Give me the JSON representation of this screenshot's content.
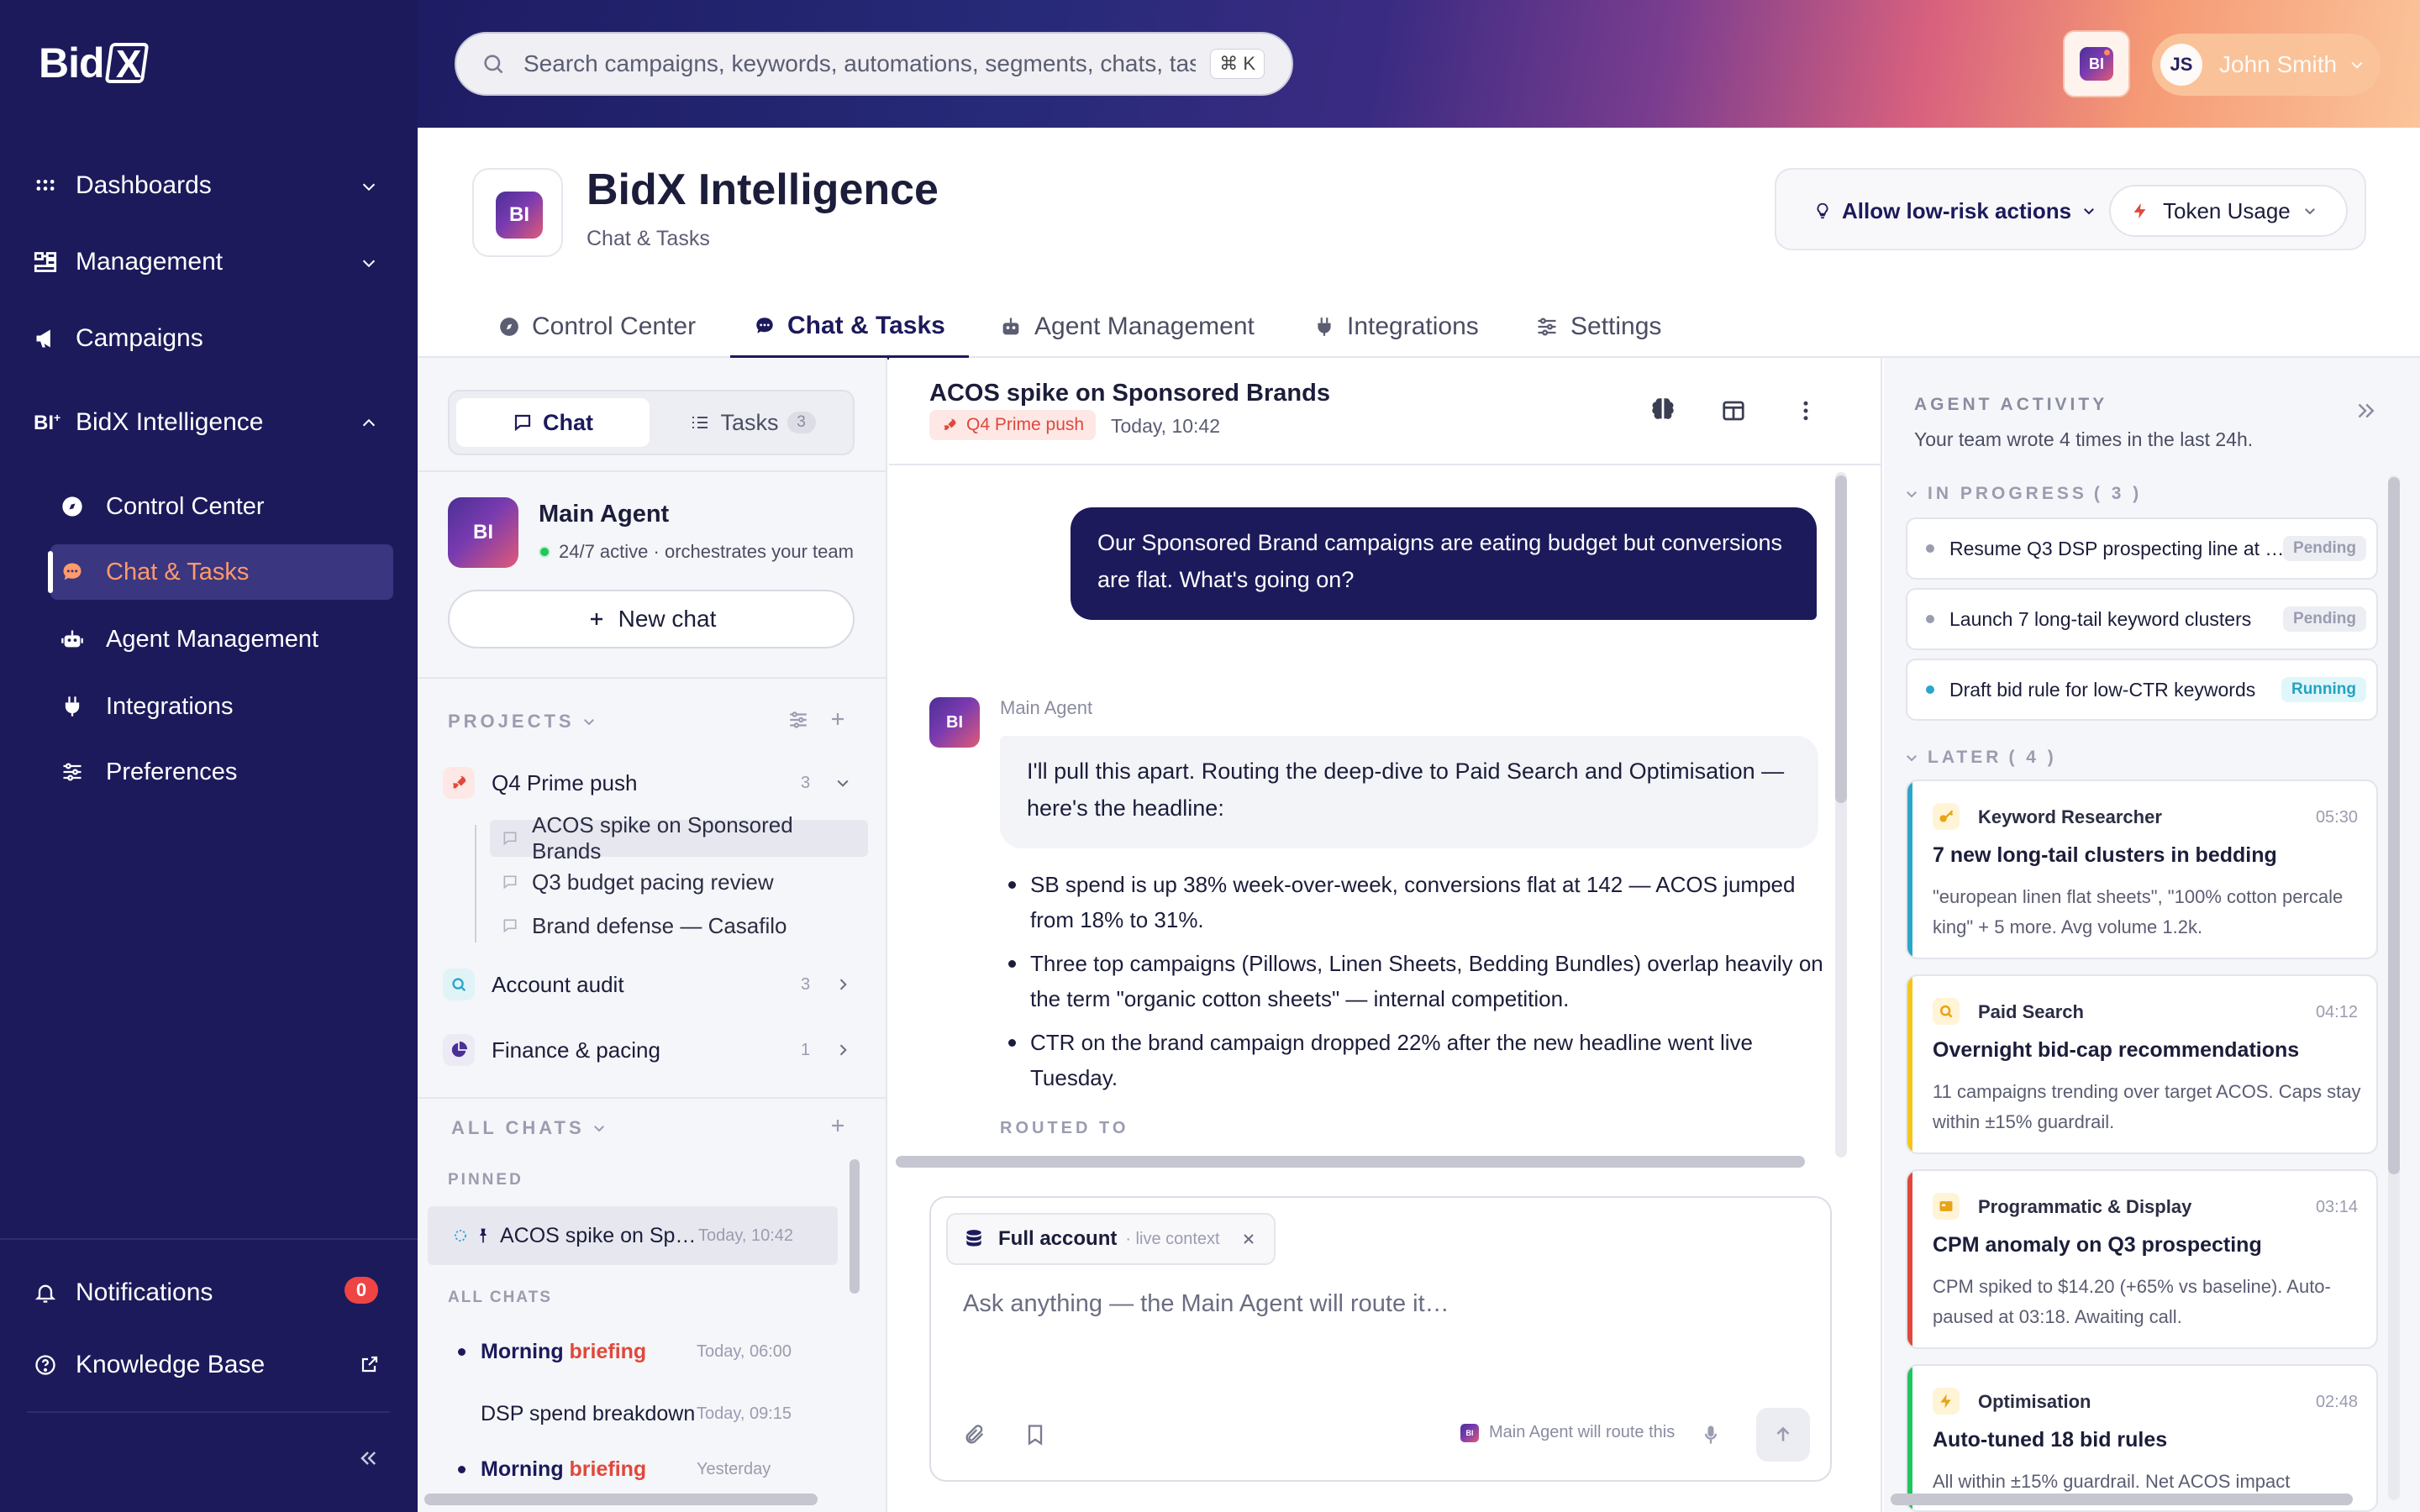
{
  "brand": {
    "logo_text": "Bid",
    "logo_mark": "X"
  },
  "sidebar": {
    "items": [
      {
        "label": "Dashboards",
        "icon": "grid-icon"
      },
      {
        "label": "Management",
        "icon": "hierarchy-icon"
      },
      {
        "label": "Campaigns",
        "icon": "megaphone-icon"
      },
      {
        "label": "BidX Intelligence",
        "icon": "bi-icon"
      }
    ],
    "subitems": [
      {
        "label": "Control Center",
        "icon": "compass-icon"
      },
      {
        "label": "Chat & Tasks",
        "icon": "chat-icon",
        "active": true
      },
      {
        "label": "Agent Management",
        "icon": "robot-icon"
      },
      {
        "label": "Integrations",
        "icon": "plug-icon"
      },
      {
        "label": "Preferences",
        "icon": "sliders-icon"
      }
    ],
    "notifications": {
      "label": "Notifications",
      "count": "0"
    },
    "knowledge_base": {
      "label": "Knowledge Base"
    },
    "collapse_icon": "double-chevron-left-icon"
  },
  "search": {
    "placeholder": "Search campaigns, keywords, automations, segments, chats, tasl",
    "shortcut": "⌘ K"
  },
  "user": {
    "initials": "JS",
    "name": "John Smith"
  },
  "page": {
    "badge": "BI",
    "title": "BidX Intelligence",
    "subtitle": "Chat & Tasks",
    "allow_label": "Allow low-risk actions",
    "token_label": "Token Usage"
  },
  "tabs": [
    {
      "label": "Control Center",
      "icon": "compass-icon"
    },
    {
      "label": "Chat & Tasks",
      "icon": "chat-icon",
      "active": true
    },
    {
      "label": "Agent Management",
      "icon": "robot-icon"
    },
    {
      "label": "Integrations",
      "icon": "plug-icon"
    },
    {
      "label": "Settings",
      "icon": "sliders-icon"
    }
  ],
  "left_panel": {
    "seg_chat": "Chat",
    "seg_tasks": "Tasks",
    "tasks_count": "3",
    "agent": {
      "badge": "BI",
      "name": "Main Agent",
      "status": "24/7 active · orchestrates your team"
    },
    "new_chat": "New chat",
    "projects_header": "PROJECTS",
    "projects": [
      {
        "label": "Q4 Prime push",
        "count": "3",
        "color": "#e0483b"
      },
      {
        "label": "Account audit",
        "count": "3",
        "color": "#2aa7c8"
      },
      {
        "label": "Finance & pacing",
        "count": "1",
        "color": "#4b2f95"
      }
    ],
    "q4_children": [
      "ACOS spike on Sponsored Brands",
      "Q3 budget pacing review",
      "Brand defense — Casafilo"
    ],
    "all_chats_header": "ALL CHATS",
    "pinned_header": "PINNED",
    "pinned_chat": {
      "label": "ACOS spike on Sp…",
      "time": "Today, 10:42"
    },
    "all_chats_sub": "ALL CHATS",
    "chats": [
      {
        "label_a": "Morning ",
        "label_b": "briefing",
        "time": "Today, 06:00"
      },
      {
        "label": "DSP spend breakdown",
        "time": "Today, 09:15"
      },
      {
        "label_a": "Morning ",
        "label_b": "briefing",
        "time": "Yesterday"
      }
    ]
  },
  "conversation": {
    "title": "ACOS spike on Sponsored Brands",
    "tag": "Q4 Prime push",
    "time": "Today, 10:42",
    "user_message": "Our Sponsored Brand campaigns are eating budget but conversions are flat. What's going on?",
    "agent_label": "Main Agent",
    "agent_badge": "BI",
    "agent_message": "I'll pull this apart. Routing the deep-dive to Paid Search and Optimisation — here's the headline:",
    "bullets": [
      "SB spend is up 38% week-over-week, conversions flat at 142 — ACOS jumped from 18% to 31%.",
      "Three top campaigns (Pillows, Linen Sheets, Bedding Bundles) overlap heavily on the term \"organic cotton sheets\" — internal competition.",
      "CTR on the brand campaign dropped 22% after the new headline went live Tuesday."
    ],
    "routed_to": "ROUTED TO"
  },
  "composer": {
    "context_label": "Full account",
    "context_sub": "· live context",
    "placeholder": "Ask anything — the Main Agent will route it…",
    "route_hint": "Main Agent will route this"
  },
  "activity": {
    "header": "AGENT ACTIVITY",
    "subtitle": "Your team wrote 4 times in the last 24h.",
    "in_progress_header": "IN PROGRESS",
    "in_progress_count": "3",
    "tasks": [
      {
        "label": "Resume Q3 DSP prospecting line at …",
        "status": "Pending"
      },
      {
        "label": "Launch 7 long-tail keyword clusters",
        "status": "Pending"
      },
      {
        "label": "Draft bid rule for low-CTR keywords",
        "status": "Running"
      }
    ],
    "later_header": "LATER",
    "later_count": "4",
    "cards": [
      {
        "agent": "Keyword Researcher",
        "time": "05:30",
        "title": "7 new long-tail clusters in bedding",
        "body": "\"european linen flat sheets\", \"100% cotton percale king\" + 5 more. Avg volume 1.2k.",
        "color": "#2aa7c8",
        "icon": "key-icon"
      },
      {
        "agent": "Paid Search",
        "time": "04:12",
        "title": "Overnight bid-cap recommendations",
        "body": "11 campaigns trending over target ACOS. Caps stay within ±15% guardrail.",
        "color": "#f5c518",
        "icon": "search-icon"
      },
      {
        "agent": "Programmatic & Display",
        "time": "03:14",
        "title": "CPM anomaly on Q3 prospecting",
        "body": "CPM spiked to $14.20 (+65% vs baseline). Auto-paused at 03:18. Awaiting call.",
        "color": "#e0483b",
        "icon": "display-icon"
      },
      {
        "agent": "Optimisation",
        "time": "02:48",
        "title": "Auto-tuned 18 bid rules",
        "body": "All within ±15% guardrail. Net ACOS impact",
        "color": "#22c55e",
        "icon": "bolt-icon"
      }
    ]
  }
}
